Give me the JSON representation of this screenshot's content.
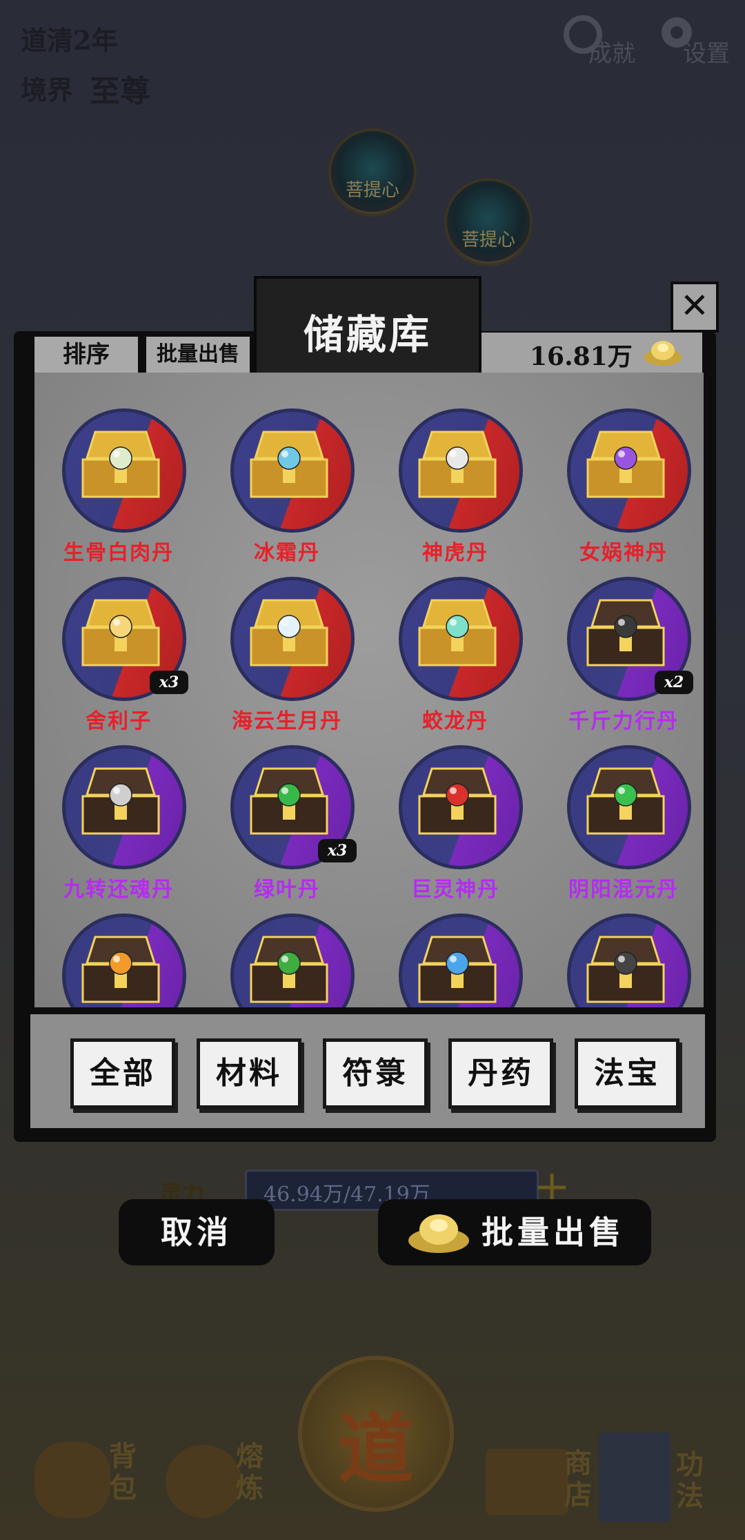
{
  "hud": {
    "realm_year_label": "道清2年",
    "realm_label": "境界",
    "realm_value": "至尊",
    "achievements_label": "成就",
    "settings_label": "设置"
  },
  "scene_orbs": [
    "菩提心",
    "菩提心"
  ],
  "storage": {
    "title": "储藏库",
    "sort_label": "排序",
    "batch_sell_tab": "批量出售",
    "currency_value": "16.81万",
    "close_glyph": "✕",
    "colors": {
      "red_quality": "#e8202a",
      "purple_quality": "#b52cf0"
    },
    "items": [
      {
        "name": "生骨白肉丹",
        "quality": "red",
        "orb": "#dfeccc",
        "count": ""
      },
      {
        "name": "冰霜丹",
        "quality": "red",
        "orb": "#6fc8e6",
        "count": ""
      },
      {
        "name": "神虎丹",
        "quality": "red",
        "orb": "#e8e8e8",
        "count": ""
      },
      {
        "name": "女娲神丹",
        "quality": "red",
        "orb": "#9a55e0",
        "count": ""
      },
      {
        "name": "舍利子",
        "quality": "red",
        "orb": "#f5d77a",
        "count": "x3"
      },
      {
        "name": "海云生月丹",
        "quality": "red",
        "orb": "#e6f2fb",
        "count": ""
      },
      {
        "name": "蛟龙丹",
        "quality": "red",
        "orb": "#7ee0c8",
        "count": ""
      },
      {
        "name": "千斤力行丹",
        "quality": "purple",
        "orb": "#3a3a3a",
        "count": "x2"
      },
      {
        "name": "九转还魂丹",
        "quality": "purple",
        "orb": "#cfcfcf",
        "count": ""
      },
      {
        "name": "绿叶丹",
        "quality": "purple",
        "orb": "#39b84a",
        "count": "x3"
      },
      {
        "name": "巨灵神丹",
        "quality": "purple",
        "orb": "#d8322a",
        "count": ""
      },
      {
        "name": "阴阳混元丹",
        "quality": "purple",
        "orb": "#3bc050",
        "count": ""
      },
      {
        "name": "",
        "quality": "purple",
        "orb": "#f29a2a",
        "count": ""
      },
      {
        "name": "",
        "quality": "purple",
        "orb": "#3fae40",
        "count": ""
      },
      {
        "name": "",
        "quality": "purple",
        "orb": "#4aa6e8",
        "count": ""
      },
      {
        "name": "",
        "quality": "purple",
        "orb": "#444444",
        "count": ""
      }
    ],
    "categories": [
      "全部",
      "材料",
      "符箓",
      "丹药",
      "法宝"
    ]
  },
  "spirit": {
    "label": "灵力",
    "value": "46.94万/47.19万",
    "plus": "+"
  },
  "actions": {
    "cancel": "取消",
    "batch_sell": "批量出售"
  },
  "bottom_nav": [
    {
      "label": "背包",
      "icon": "bag-icon"
    },
    {
      "label": "熔炼",
      "icon": "furnace-icon"
    },
    {
      "label": "道",
      "icon": "dao-seal-icon"
    },
    {
      "label": "商店",
      "icon": "scroll-icon"
    },
    {
      "label": "功法",
      "icon": "book-icon"
    }
  ]
}
